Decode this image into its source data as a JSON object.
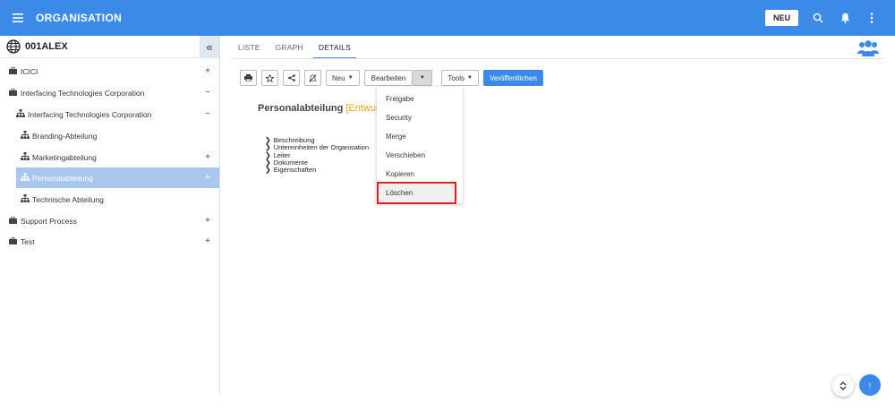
{
  "header": {
    "title": "ORGANISATION",
    "new_label": "NEU",
    "icons": [
      "menu-icon",
      "search-icon",
      "bell-icon",
      "more-vert-icon"
    ],
    "accent": "#3c8ae8"
  },
  "sidebar": {
    "title": "001ALEX",
    "items": [
      {
        "label": "ICICI",
        "toggle": "+"
      },
      {
        "label": "Interfacing Technologies Corporation",
        "toggle": "−"
      },
      {
        "label": "Interfacing Technologies Corporation",
        "toggle": "−"
      },
      {
        "label": "Branding-Abteilung",
        "toggle": ""
      },
      {
        "label": "Marketingabteilung",
        "toggle": "+"
      },
      {
        "label": "Personalabteilung",
        "toggle": "+"
      },
      {
        "label": "Technische Abteilung",
        "toggle": ""
      },
      {
        "label": "Support Process",
        "toggle": "+"
      },
      {
        "label": "Test",
        "toggle": "+"
      }
    ]
  },
  "tabs": [
    "LISTE",
    "GRAPH",
    "DETAILS"
  ],
  "toolbar": {
    "neu": "Neu",
    "bearbeiten": "Bearbeiten",
    "tools": "Tools",
    "publish": "Veröffentlichen"
  },
  "detail": {
    "title": "Personalabteilung",
    "status": "[Entwurf]",
    "sections": [
      "Beschreibung",
      "Untereinheiten der Organisation",
      "Leiter",
      "Dokumente",
      "Eigenschaften"
    ]
  },
  "dropdown": {
    "items": [
      "Freigabe",
      "Security",
      "Merge",
      "Verschieben",
      "Kopieren",
      "Löschen"
    ],
    "highlighted": "Löschen"
  }
}
